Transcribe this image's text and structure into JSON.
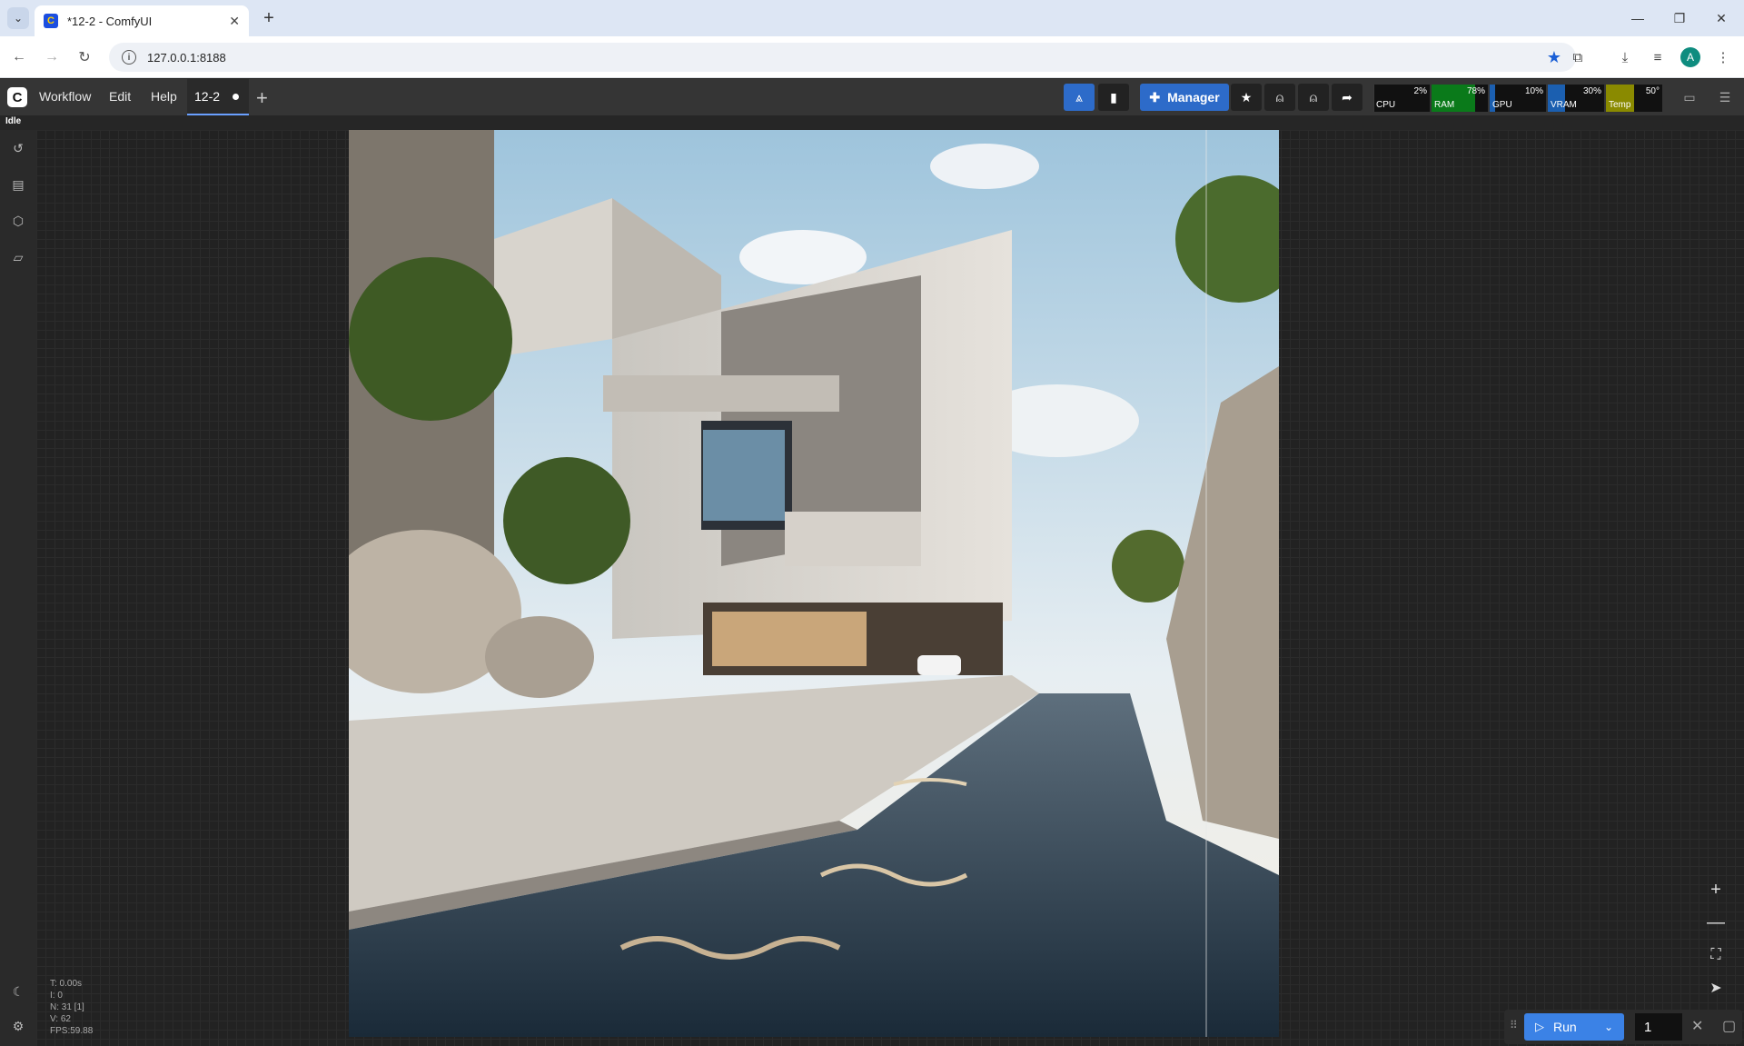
{
  "browser": {
    "tab_title": "*12-2 - ComfyUI",
    "url": "127.0.0.1:8188"
  },
  "menu": {
    "items": [
      "Workflow",
      "Edit",
      "Help"
    ],
    "workflow_tab": "12-2",
    "manager_label": "Manager"
  },
  "monitors": [
    {
      "label": "CPU",
      "value": "2%",
      "percent": 2,
      "color": "#3a3a3a"
    },
    {
      "label": "RAM",
      "value": "78%",
      "percent": 78,
      "color": "#0a7a1a"
    },
    {
      "label": "GPU",
      "value": "10%",
      "percent": 10,
      "color": "#1b5fb0"
    },
    {
      "label": "VRAM",
      "value": "30%",
      "percent": 30,
      "color": "#1b5fb0"
    },
    {
      "label": "Temp",
      "value": "50°",
      "percent": 50,
      "color": "#8a8a00"
    }
  ],
  "status": "Idle",
  "stats": {
    "t": "T: 0.00s",
    "i": "I: 0",
    "n": "N: 31 [1]",
    "v": "V: 62",
    "fps": "FPS:59.88"
  },
  "run": {
    "label": "Run",
    "count": "1"
  },
  "colors": {
    "accent": "#3b82e6",
    "manager": "#2d6bc9"
  }
}
